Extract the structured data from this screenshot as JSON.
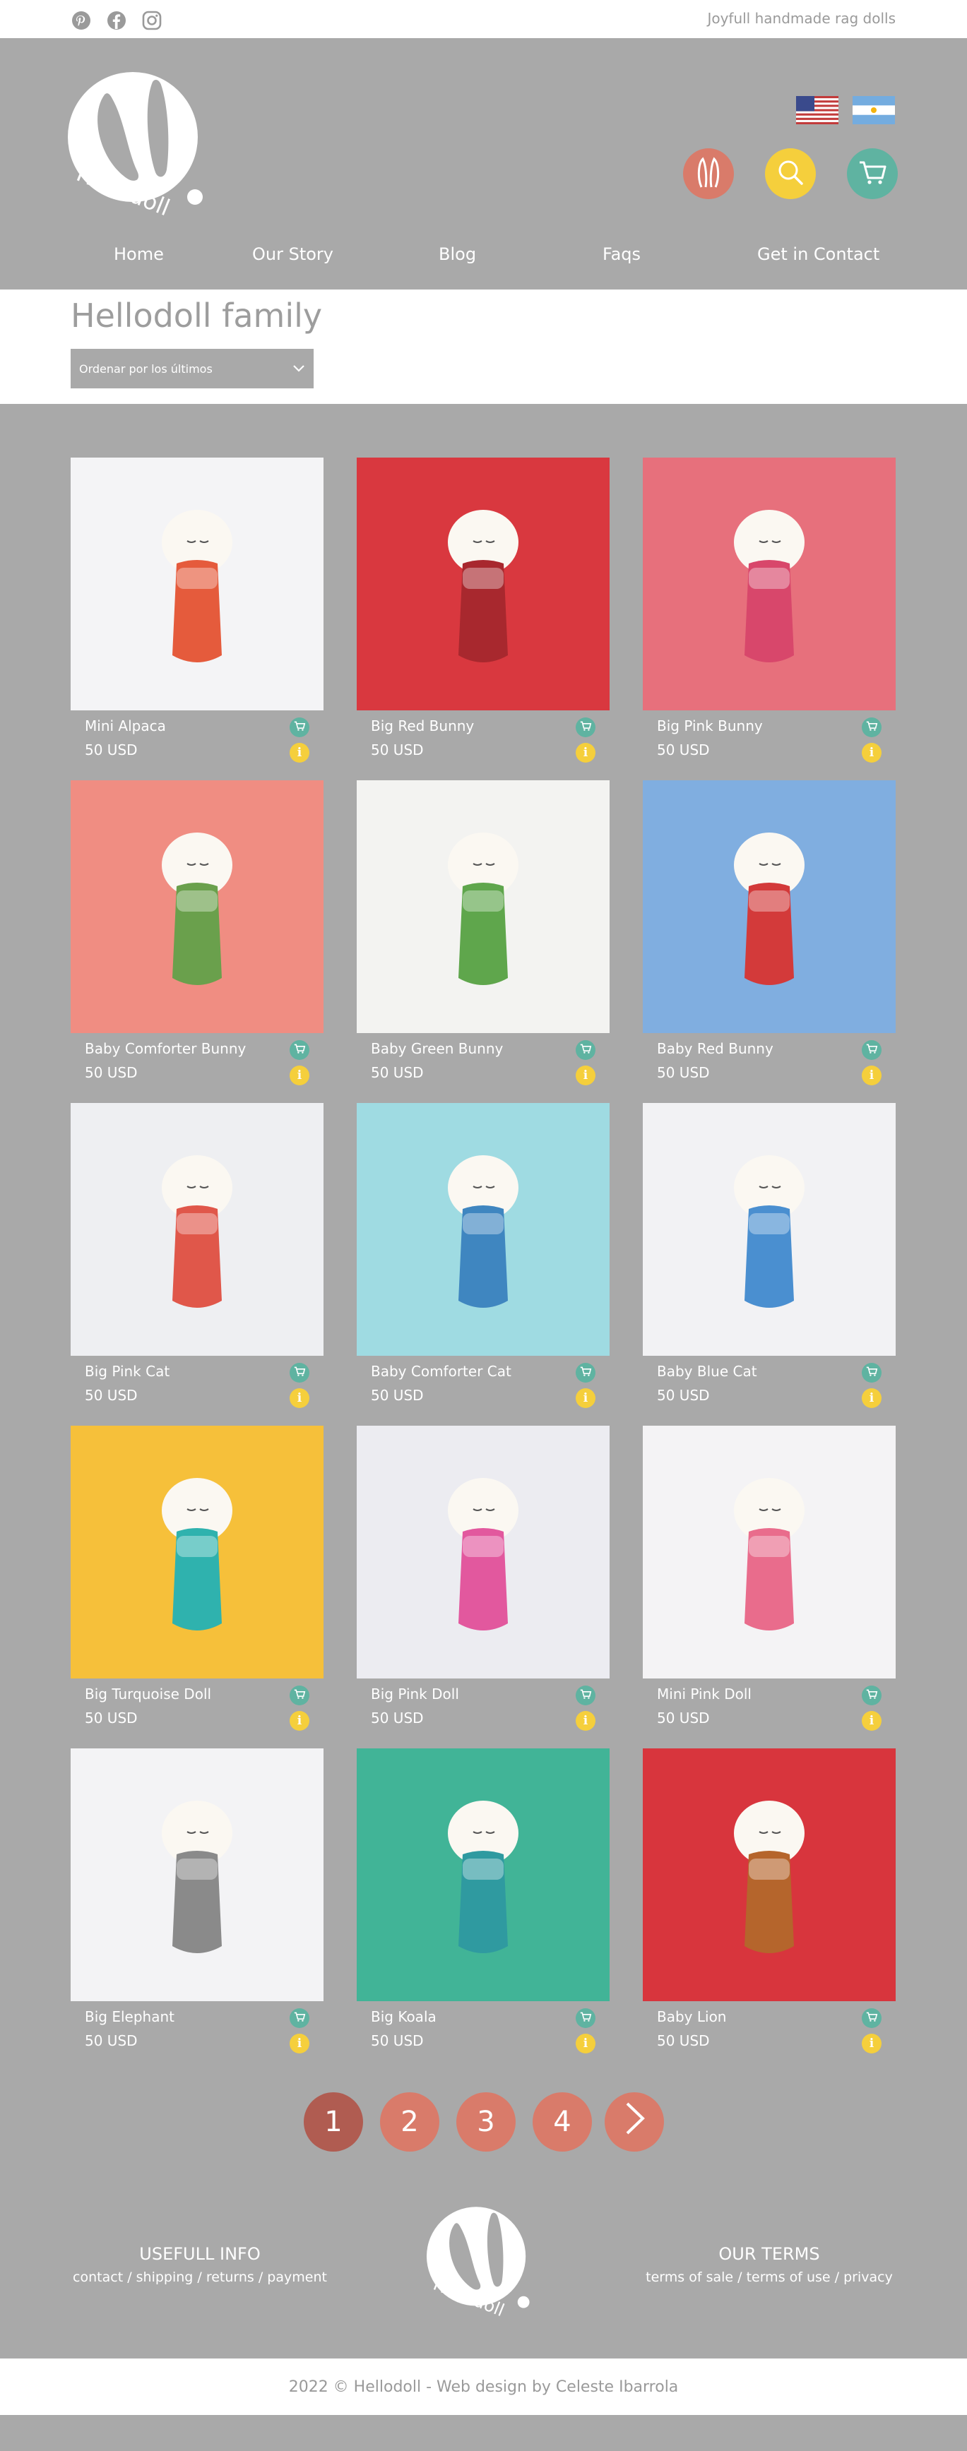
{
  "topbar": {
    "social": [
      "pinterest-icon",
      "facebook-icon",
      "instagram-icon"
    ],
    "tagline": "Joyfull handmade rag dolls"
  },
  "header": {
    "brand": "Hellodoll",
    "flags": [
      "us-flag",
      "argentina-flag"
    ],
    "buttons": [
      {
        "icon": "bunny-ears-icon",
        "color": "#d97b6a"
      },
      {
        "icon": "search-icon",
        "color": "#f5cf3c"
      },
      {
        "icon": "cart-icon",
        "color": "#5fb3a1"
      }
    ],
    "nav": [
      "Home",
      "Our Story",
      "Blog",
      "Faqs",
      "Get in Contact"
    ]
  },
  "page": {
    "title": "Hellodoll family",
    "sort_label": "Ordenar por los últimos"
  },
  "products": [
    {
      "name": "Mini Alpaca",
      "price": "50 USD",
      "bg": "#f4f4f6",
      "accent": "#e55b3c"
    },
    {
      "name": "Big Red Bunny",
      "price": "50 USD",
      "bg": "#d9383f",
      "accent": "#a8282e"
    },
    {
      "name": "Big Pink Bunny",
      "price": "50 USD",
      "bg": "#e7707c",
      "accent": "#d8476b"
    },
    {
      "name": "Baby Comforter Bunny",
      "price": "50 USD",
      "bg": "#f08d82",
      "accent": "#6aa04c"
    },
    {
      "name": "Baby Green Bunny",
      "price": "50 USD",
      "bg": "#f3f3f1",
      "accent": "#5fa64c"
    },
    {
      "name": "Baby Red Bunny",
      "price": "50 USD",
      "bg": "#80aee0",
      "accent": "#d33a3a"
    },
    {
      "name": "Big Pink Cat",
      "price": "50 USD",
      "bg": "#eeeff2",
      "accent": "#e0574a"
    },
    {
      "name": "Baby Comforter Cat",
      "price": "50 USD",
      "bg": "#9fdbe2",
      "accent": "#3f86c0"
    },
    {
      "name": "Baby Blue Cat",
      "price": "50 USD",
      "bg": "#f2f2f4",
      "accent": "#4a8fd0"
    },
    {
      "name": "Big Turquoise Doll",
      "price": "50 USD",
      "bg": "#f6c03a",
      "accent": "#2fb2ae"
    },
    {
      "name": "Big Pink Doll",
      "price": "50 USD",
      "bg": "#ececf1",
      "accent": "#e2589e"
    },
    {
      "name": "Mini Pink Doll",
      "price": "50 USD",
      "bg": "#f4f3f5",
      "accent": "#e96c8c"
    },
    {
      "name": "Big Elephant",
      "price": "50 USD",
      "bg": "#f3f3f5",
      "accent": "#8a8a8a"
    },
    {
      "name": "Big Koala",
      "price": "50 USD",
      "bg": "#41b497",
      "accent": "#2f9aa0"
    },
    {
      "name": "Baby Lion",
      "price": "50 USD",
      "bg": "#d8353d",
      "accent": "#b5652c"
    }
  ],
  "pagination": {
    "pages": [
      "1",
      "2",
      "3",
      "4"
    ],
    "current": "1",
    "next_icon": "chevron-right-icon"
  },
  "footer": {
    "left_title": "USEFULL INFO",
    "left_links": "contact / shipping / returns / payment",
    "right_title": "OUR TERMS",
    "right_links": "terms of sale / terms of use / privacy",
    "copyright": "2022 © Hellodoll - Web design by Celeste Ibarrola"
  },
  "colors": {
    "gray": "#a9a9a9",
    "coral": "#d97b6a",
    "yellow": "#f5cf3c",
    "teal": "#5fb3a1"
  }
}
